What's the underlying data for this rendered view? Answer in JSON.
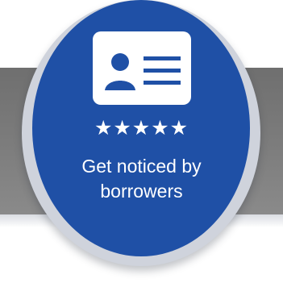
{
  "badge": {
    "rating_stars": "★★★★★",
    "caption_line1": "Get noticed by",
    "caption_line2": "borrowers",
    "icon": "id-card-icon"
  },
  "colors": {
    "badge_blue": "#1f50a6",
    "ring_gray": "#cfd3dc",
    "band_gray": "#7d7d7d",
    "text_white": "#ffffff"
  }
}
